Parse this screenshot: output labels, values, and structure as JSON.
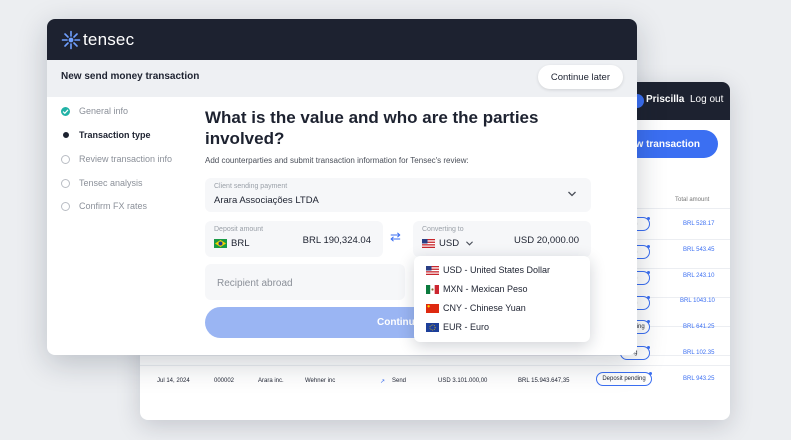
{
  "background_window": {
    "user_name": "Priscilla",
    "logout_label": "Log out",
    "new_transaction_label": "New transaction",
    "column_header": "Total amount",
    "badges": [
      ".s",
      ".s",
      ".s",
      ".s",
      "Deposit pending",
      ".g",
      "Deposit pending"
    ],
    "amounts": [
      "BRL 528.17",
      "BRL 543.45",
      "BRL 243.10",
      "BRL 1043.10",
      "BRL 641.25",
      "BRL 102.35",
      "BRL 943.25"
    ],
    "last_row": {
      "date": "Jul 14, 2024",
      "id": "000002",
      "company": "Arara inc.",
      "counterparty": "Wehner inc",
      "direction": "Send",
      "usd_amount": "USD 3.101.000,00",
      "brl_amount": "BRL 15.943.647,35"
    }
  },
  "header": {
    "brand": "tensec",
    "subtitle": "New send money transaction",
    "continue_later": "Continue later"
  },
  "steps": [
    {
      "label": "General info",
      "state": "done"
    },
    {
      "label": "Transaction type",
      "state": "active"
    },
    {
      "label": "Review transaction info",
      "state": "pending"
    },
    {
      "label": "Tensec analysis",
      "state": "pending"
    },
    {
      "label": "Confirm FX rates",
      "state": "pending"
    }
  ],
  "form": {
    "heading": "What is the value and who are the parties involved?",
    "description": "Add counterparties and submit transaction information for Tensec's review:",
    "client_label": "Client sending payment",
    "client_value": "Arara Associações LTDA",
    "deposit_label": "Deposit amount",
    "deposit_currency": "BRL",
    "deposit_amount": "BRL 190,324.04",
    "converting_label": "Converting to",
    "converting_currency": "USD",
    "converting_amount": "USD 20,000.00",
    "recipient_placeholder": "Recipient abroad",
    "continue_label": "Continu"
  },
  "currency_options": [
    {
      "label": "USD - United States Dollar",
      "flag": "us-flag"
    },
    {
      "label": "MXN - Mexican Peso",
      "flag": "mx-flag"
    },
    {
      "label": "CNY - Chinese Yuan",
      "flag": "cn-flag"
    },
    {
      "label": "EUR - Euro",
      "flag": "eu-flag"
    }
  ],
  "colors": {
    "accent": "#3b6ff2",
    "dark": "#1d2230",
    "success": "#21b2a6"
  }
}
